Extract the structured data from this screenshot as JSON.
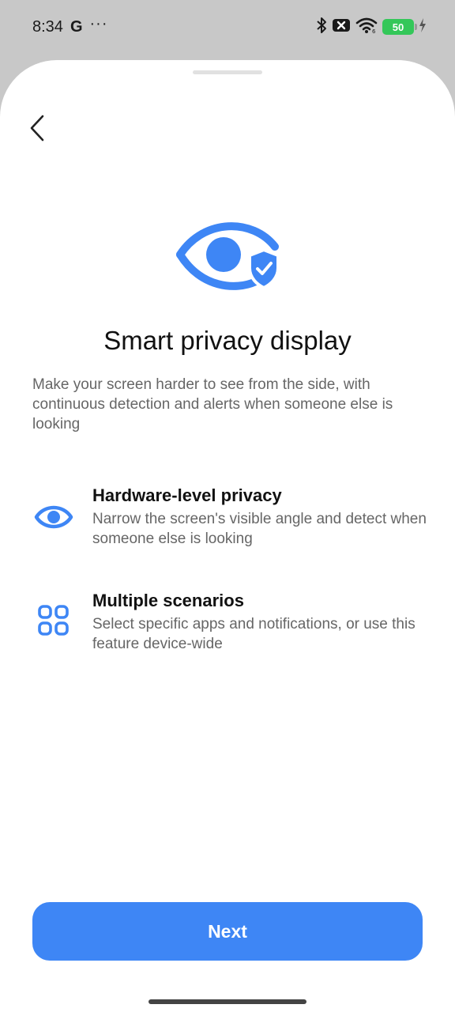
{
  "status_bar": {
    "time": "8:34",
    "google_icon": "G",
    "overflow": "···",
    "battery_level": "50",
    "icons": [
      "bluetooth-icon",
      "no-sim-icon",
      "wifi-icon",
      "battery-icon",
      "charging-icon"
    ]
  },
  "page": {
    "title": "Smart privacy display",
    "description": "Make your screen harder to see from the side, with continuous detection and alerts when someone else is looking"
  },
  "features": [
    {
      "icon": "eye-icon",
      "title": "Hardware-level privacy",
      "description": "Narrow the screen's visible angle and detect when someone else is looking"
    },
    {
      "icon": "apps-grid-icon",
      "title": "Multiple scenarios",
      "description": "Select specific apps and notifications, or use this feature device-wide"
    }
  ],
  "actions": {
    "next_label": "Next"
  },
  "colors": {
    "accent": "#3e86f5",
    "battery": "#34c759",
    "sheet": "#ffffff",
    "scrim": "#c8c8c8"
  }
}
